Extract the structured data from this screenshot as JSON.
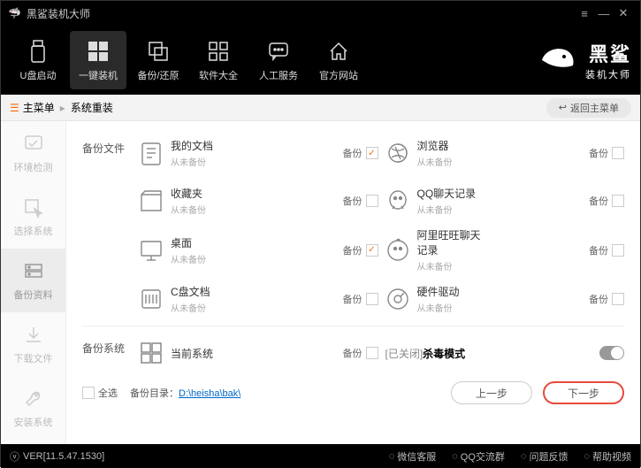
{
  "window": {
    "title": "黑鲨装机大师"
  },
  "nav": {
    "items": [
      {
        "label": "U盘启动"
      },
      {
        "label": "一键装机"
      },
      {
        "label": "备份/还原"
      },
      {
        "label": "软件大全"
      },
      {
        "label": "人工服务"
      },
      {
        "label": "官方网站"
      }
    ],
    "brand_big": "黑鲨",
    "brand_small": "装机大师"
  },
  "crumb": {
    "main": "主菜单",
    "sub": "系统重装",
    "back": "返回主菜单"
  },
  "side": [
    {
      "label": "环境检测"
    },
    {
      "label": "选择系统"
    },
    {
      "label": "备份资料"
    },
    {
      "label": "下载文件"
    },
    {
      "label": "安装系统"
    }
  ],
  "sections": {
    "files_title": "备份文件",
    "sys_title": "备份系统",
    "backup_label": "备份",
    "never": "从未备份",
    "items_left": [
      {
        "name": "我的文档",
        "checked": true
      },
      {
        "name": "收藏夹",
        "checked": false
      },
      {
        "name": "桌面",
        "checked": true
      },
      {
        "name": "C盘文档",
        "checked": false
      }
    ],
    "items_right": [
      {
        "name": "浏览器",
        "checked": false
      },
      {
        "name": "QQ聊天记录",
        "checked": false
      },
      {
        "name": "阿里旺旺聊天记录",
        "checked": false
      },
      {
        "name": "硬件驱动",
        "checked": false
      }
    ],
    "sys_item": {
      "name": "当前系统",
      "checked": false
    },
    "kill_prefix": "[已关闭] ",
    "kill_label": "杀毒模式"
  },
  "bottom": {
    "selectall": "全选",
    "dir_label": "备份目录：",
    "dir_path": "D:\\heisha\\bak\\",
    "prev": "上一步",
    "next": "下一步"
  },
  "footer": {
    "ver": "VER[11.5.47.1530]",
    "links": [
      "微信客服",
      "QQ交流群",
      "问题反馈",
      "帮助视频"
    ]
  }
}
